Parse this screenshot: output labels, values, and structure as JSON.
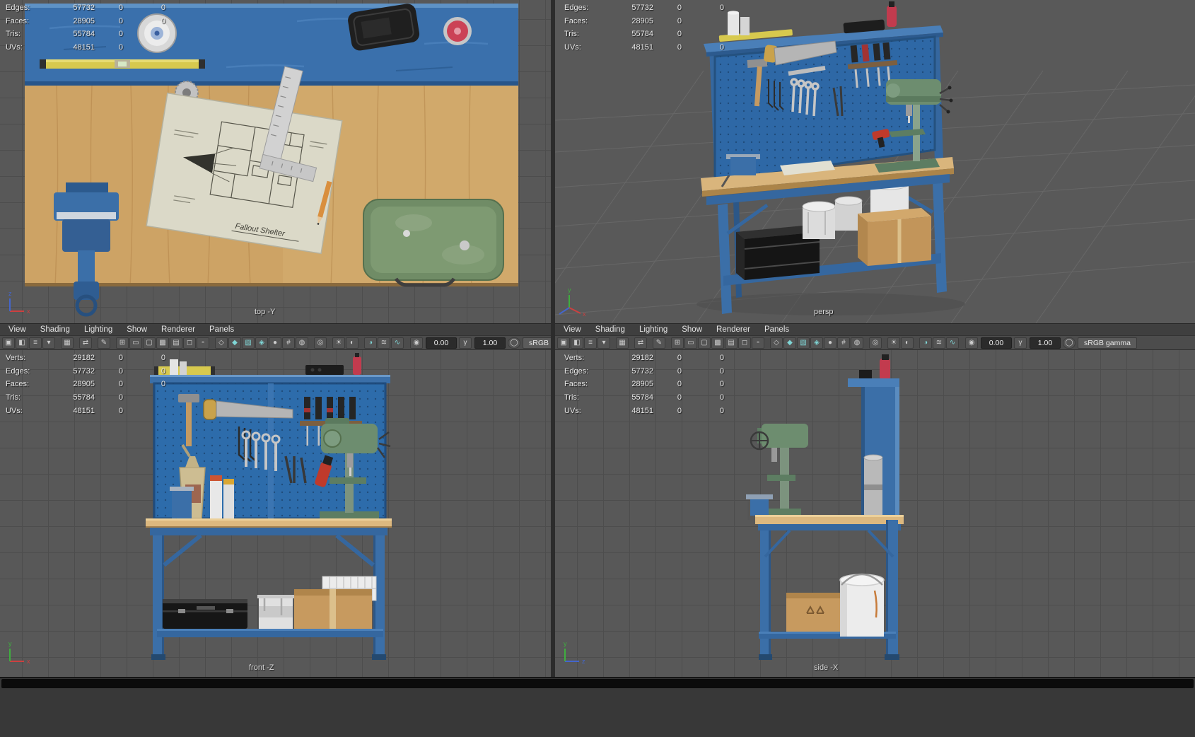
{
  "colors": {
    "bench_blue": "#3b6fa8",
    "pegboard_blue": "#2d6cab",
    "wood_tan": "#d9b57c",
    "viewport_gray": "#585858",
    "hud_text": "#e8e8e8",
    "extinguisher_red": "#c23b4e",
    "drill_green": "#6d8d6f",
    "level_yellow": "#d7c94e"
  },
  "panel_menu": [
    "View",
    "Shading",
    "Lighting",
    "Show",
    "Renderer",
    "Panels"
  ],
  "panel_toolbar": {
    "icons": [
      {
        "name": "select-camera-icon",
        "glyph": "▣"
      },
      {
        "name": "lock-camera-icon",
        "glyph": "◧"
      },
      {
        "name": "camera-attributes-icon",
        "glyph": "≡"
      },
      {
        "name": "bookmarks-icon",
        "glyph": "▾"
      },
      {
        "name": "image-plane-icon",
        "glyph": "▦",
        "gap": true
      },
      {
        "name": "2d-pan-zoom-icon",
        "glyph": "⇄",
        "gap": true
      },
      {
        "name": "grease-pencil-icon",
        "glyph": "✎",
        "gap": true
      },
      {
        "name": "grid-icon",
        "glyph": "⊞",
        "gap": true
      },
      {
        "name": "film-gate-icon",
        "glyph": "▭"
      },
      {
        "name": "resolution-gate-icon",
        "glyph": "▢"
      },
      {
        "name": "gate-mask-icon",
        "glyph": "▩"
      },
      {
        "name": "field-chart-icon",
        "glyph": "▤"
      },
      {
        "name": "safe-action-icon",
        "glyph": "◻"
      },
      {
        "name": "safe-title-icon",
        "glyph": "▫"
      },
      {
        "name": "wireframe-icon",
        "glyph": "◇",
        "gap": true
      },
      {
        "name": "shaded-icon",
        "glyph": "◆",
        "tone": "cyan"
      },
      {
        "name": "textured-icon",
        "glyph": "▧",
        "tone": "cyan"
      },
      {
        "name": "wireframe-on-shaded-icon",
        "glyph": "◈",
        "tone": "cyan"
      },
      {
        "name": "default-material-icon",
        "glyph": "●"
      },
      {
        "name": "xray-joints-icon",
        "glyph": "#"
      },
      {
        "name": "xray-icon",
        "glyph": "◍"
      },
      {
        "name": "isolate-select-icon",
        "glyph": "◎",
        "gap": true
      },
      {
        "name": "all-lights-icon",
        "glyph": "☀",
        "gap": true
      },
      {
        "name": "shadows-icon",
        "glyph": "◐"
      },
      {
        "name": "ambient-occlusion-icon",
        "glyph": "◑",
        "tone": "cyan",
        "gap": true
      },
      {
        "name": "motion-blur-icon",
        "glyph": "≋"
      },
      {
        "name": "anti-aliasing-icon",
        "glyph": "∿",
        "tone": "cyan"
      }
    ],
    "exposure_icon": "◉",
    "exposure_value": "0.00",
    "gamma_icon": "γ",
    "gamma_value": "1.00",
    "color_management_icon": "◯",
    "color_space": "sRGB gamma"
  },
  "viewports": {
    "top": {
      "label": "top -Y",
      "hud": [
        {
          "label": "Edges:",
          "a": "57732",
          "b": "0",
          "c": "0"
        },
        {
          "label": "Faces:",
          "a": "28905",
          "b": "0",
          "c": "0"
        },
        {
          "label": "Tris:",
          "a": "55784",
          "b": "0"
        },
        {
          "label": "UVs:",
          "a": "48151",
          "b": "0"
        }
      ]
    },
    "persp": {
      "label": "persp",
      "hud": [
        {
          "label": "Edges:",
          "a": "57732",
          "b": "0",
          "c": "0"
        },
        {
          "label": "Faces:",
          "a": "28905",
          "b": "0"
        },
        {
          "label": "Tris:",
          "a": "55784",
          "b": "0"
        },
        {
          "label": "UVs:",
          "a": "48151",
          "b": "0",
          "c": "0"
        }
      ]
    },
    "front": {
      "label": "front -Z",
      "hud": [
        {
          "label": "Verts:",
          "a": "29182",
          "b": "0",
          "c": "0"
        },
        {
          "label": "Edges:",
          "a": "57732",
          "b": "0",
          "c": "0"
        },
        {
          "label": "Faces:",
          "a": "28905",
          "b": "0",
          "c": "0"
        },
        {
          "label": "Tris:",
          "a": "55784",
          "b": "0"
        },
        {
          "label": "UVs:",
          "a": "48151",
          "b": "0"
        }
      ]
    },
    "side": {
      "label": "side -X",
      "hud": [
        {
          "label": "Verts:",
          "a": "29182",
          "b": "0",
          "c": "0"
        },
        {
          "label": "Edges:",
          "a": "57732",
          "b": "0",
          "c": "0"
        },
        {
          "label": "Faces:",
          "a": "28905",
          "b": "0",
          "c": "0"
        },
        {
          "label": "Tris:",
          "a": "55784",
          "b": "0",
          "c": "0"
        },
        {
          "label": "UVs:",
          "a": "48151",
          "b": "0",
          "c": "0"
        }
      ]
    }
  },
  "scene": {
    "blueprint_title": "Fallout Shelter"
  }
}
